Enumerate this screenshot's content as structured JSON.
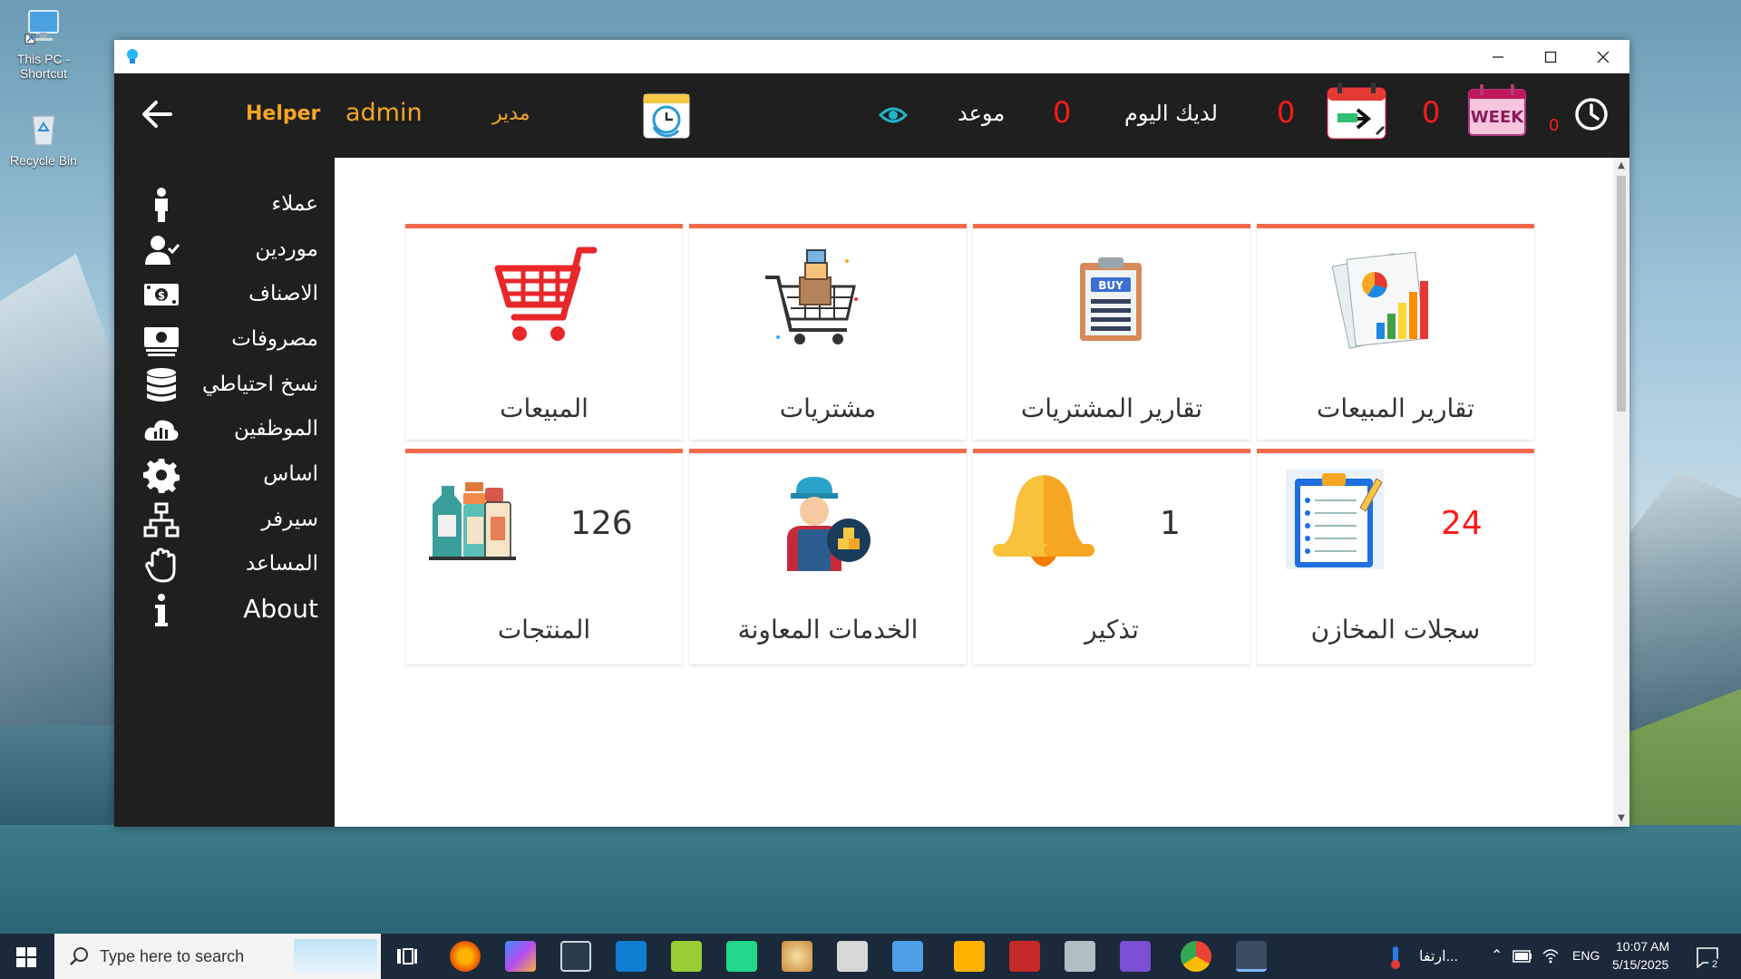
{
  "desktop": {
    "icons": [
      {
        "label": "This PC - Shortcut"
      },
      {
        "label": "Recycle Bin"
      }
    ]
  },
  "header": {
    "helper": "Helper",
    "user": "admin",
    "role": "مدير",
    "appointment_label": "موعد",
    "appointment_count": "0",
    "today_label": "لديك اليوم",
    "today_count": "0",
    "transfer_count": "0",
    "week_icon_text": "WEEK",
    "clock_count": "0",
    "colors": {
      "accent": "#f5a623",
      "count": "#ff1a1a",
      "eye": "#1fb5c7"
    }
  },
  "sidebar": {
    "items": [
      {
        "label": "عملاء",
        "icon": "person-icon"
      },
      {
        "label": "موردين",
        "icon": "user-check-icon"
      },
      {
        "label": "الاصناف",
        "icon": "money-icon"
      },
      {
        "label": "مصروفات",
        "icon": "cash-stack-icon"
      },
      {
        "label": "نسخ احتياطي",
        "icon": "database-icon"
      },
      {
        "label": "الموظفين",
        "icon": "cloud-chart-icon"
      },
      {
        "label": "اساس",
        "icon": "gear-icon"
      },
      {
        "label": "سيرفر",
        "icon": "network-icon"
      },
      {
        "label": "المساعد",
        "icon": "hand-icon"
      },
      {
        "label": "About",
        "icon": "info-icon"
      }
    ]
  },
  "cards": {
    "row1": [
      {
        "title": "تقارير المبيعات",
        "icon": "sales-report-icon"
      },
      {
        "title": "تقارير المشتريات",
        "icon": "buy-clipboard-icon",
        "badge": "BUY"
      },
      {
        "title": "مشتريات",
        "icon": "purchase-cart-icon"
      },
      {
        "title": "المبيعات",
        "icon": "sales-cart-icon"
      }
    ],
    "row2": [
      {
        "title": "سجلات المخازن",
        "icon": "checklist-icon",
        "count": "24"
      },
      {
        "title": "تذكير",
        "icon": "bell-icon",
        "count": "1"
      },
      {
        "title": "الخدمات المعاونة",
        "icon": "delivery-worker-icon"
      },
      {
        "title": "المنتجات",
        "icon": "products-icon",
        "count": "126"
      }
    ]
  },
  "taskbar": {
    "search_placeholder": "Type here to search",
    "weather_text": "ارتفا...",
    "language": "ENG",
    "time": "10:07 AM",
    "date": "5/15/2025",
    "notification_count": "2"
  }
}
